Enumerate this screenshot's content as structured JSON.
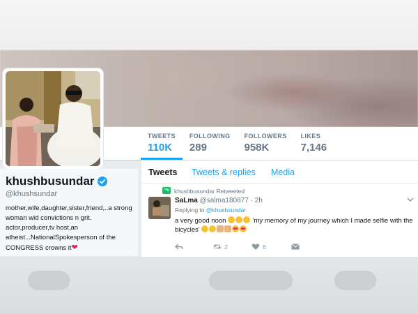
{
  "profile": {
    "name": "khushbusundar",
    "handle": "@khushsundar",
    "bio": "mother,wife,daughter,sister,friend,..a strong woman wid convictions n grit. actor,producer,tv host,an atheist...NationalSpokesperson of the CONGRESS crowns it"
  },
  "stats": [
    {
      "label": "TWEETS",
      "value": "110K"
    },
    {
      "label": "FOLLOWING",
      "value": "289"
    },
    {
      "label": "FOLLOWERS",
      "value": "958K"
    },
    {
      "label": "LIKES",
      "value": "7,146"
    }
  ],
  "tabs": [
    {
      "label": "Tweets"
    },
    {
      "label": "Tweets & replies"
    },
    {
      "label": "Media"
    }
  ],
  "tweet": {
    "retweeted_by": "khushbusundar Retweeted",
    "author_name": "SaLma",
    "author_handle": "@salma180877",
    "time": "· 2h",
    "replying_prefix": "Replying to",
    "replying_handle": "@khushsundar",
    "text_part1": "a very good noon ",
    "text_part2": " 'my memory of my journey which I made selfie with the bicycles'",
    "retweet_count": "2",
    "like_count": "6"
  },
  "colors": {
    "accent": "#1da1f2",
    "verified": "#1da1f2",
    "heart": "#e0245e",
    "retweet": "#17bf63"
  }
}
